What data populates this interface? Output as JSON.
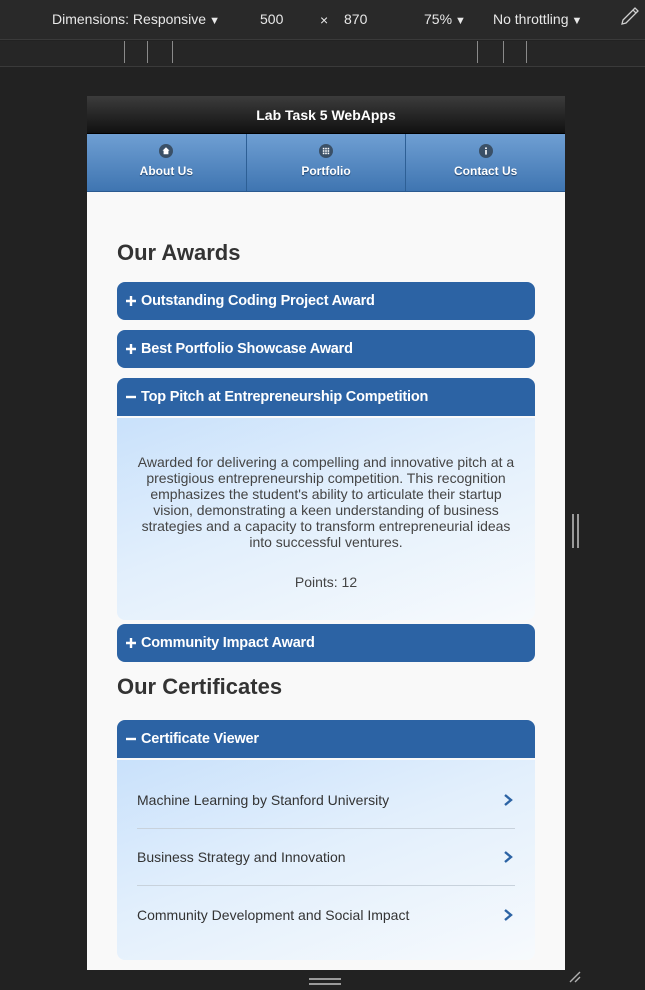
{
  "devtools": {
    "dimensions_label": "Dimensions: Responsive",
    "width": "500",
    "times": "×",
    "height": "870",
    "zoom": "75%",
    "throttling": "No throttling"
  },
  "app": {
    "title": "Lab Task 5 WebApps",
    "nav": [
      {
        "label": "About Us",
        "icon": "home-icon"
      },
      {
        "label": "Portfolio",
        "icon": "grid-icon"
      },
      {
        "label": "Contact Us",
        "icon": "info-icon"
      }
    ]
  },
  "awards": {
    "title": "Our Awards",
    "items": [
      {
        "label": "Outstanding Coding Project Award",
        "state": "collapsed"
      },
      {
        "label": "Best Portfolio Showcase Award",
        "state": "collapsed"
      },
      {
        "label": "Top Pitch at Entrepreneurship Competition",
        "state": "expanded",
        "description": "Awarded for delivering a compelling and innovative pitch at a prestigious entrepreneurship competition. This recognition emphasizes the student's ability to articulate their startup vision, demonstrating a keen understanding of business strategies and a capacity to transform entrepreneurial ideas into successful ventures.",
        "points": "Points: 12"
      },
      {
        "label": "Community Impact Award",
        "state": "collapsed"
      }
    ]
  },
  "certificates": {
    "title": "Our Certificates",
    "viewer_label": "Certificate Viewer",
    "items": [
      "Machine Learning by Stanford University",
      "Business Strategy and Innovation",
      "Community Development and Social Impact"
    ]
  },
  "colors": {
    "accent": "#2c63a4",
    "nav_gradient_top": "#6f9fd3",
    "header_dark": "#111111"
  }
}
